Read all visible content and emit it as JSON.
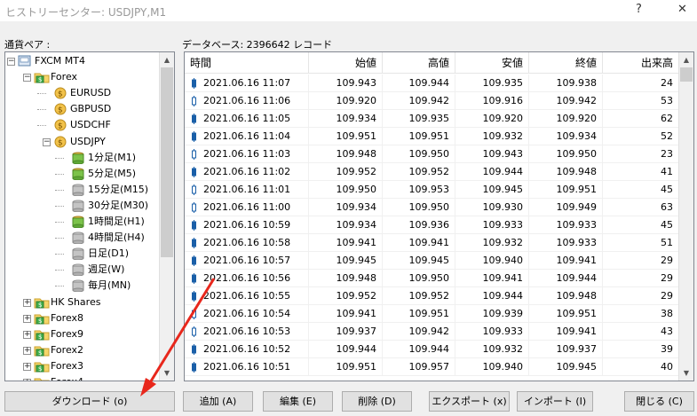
{
  "window": {
    "title": "ヒストリーセンター: USDJPY,M1",
    "help": "?",
    "close": "✕"
  },
  "left": {
    "label": "通貨ペア :"
  },
  "right": {
    "label": "データベース: 2396642 レコード"
  },
  "tree": [
    {
      "text": "FXCM MT4",
      "icon": "server-icon"
    },
    {
      "text": "Forex",
      "icon": "folder-icon"
    },
    {
      "text": "EURUSD",
      "icon": "symbol-icon"
    },
    {
      "text": "GBPUSD",
      "icon": "symbol-icon"
    },
    {
      "text": "USDCHF",
      "icon": "symbol-icon"
    },
    {
      "text": "USDJPY",
      "icon": "symbol-icon"
    },
    {
      "text": "1分足(M1)",
      "icon": "db-green-icon"
    },
    {
      "text": "5分足(M5)",
      "icon": "db-green-icon"
    },
    {
      "text": "15分足(M15)",
      "icon": "db-gray-icon"
    },
    {
      "text": "30分足(M30)",
      "icon": "db-gray-icon"
    },
    {
      "text": "1時間足(H1)",
      "icon": "db-green-icon"
    },
    {
      "text": "4時間足(H4)",
      "icon": "db-gray-icon"
    },
    {
      "text": "日足(D1)",
      "icon": "db-gray-icon"
    },
    {
      "text": "週足(W)",
      "icon": "db-gray-icon"
    },
    {
      "text": "毎月(MN)",
      "icon": "db-gray-icon"
    },
    {
      "text": "HK Shares",
      "icon": "folder-icon"
    },
    {
      "text": "Forex8",
      "icon": "folder-icon"
    },
    {
      "text": "Forex9",
      "icon": "folder-icon"
    },
    {
      "text": "Forex2",
      "icon": "folder-icon"
    },
    {
      "text": "Forex3",
      "icon": "folder-icon"
    },
    {
      "text": "Forex4",
      "icon": "folder-icon"
    }
  ],
  "table": {
    "headers": [
      "時間",
      "始値",
      "高値",
      "安値",
      "終値",
      "出来高"
    ],
    "rows": [
      [
        "2021.06.16 11:07",
        "109.943",
        "109.944",
        "109.935",
        "109.938",
        "24"
      ],
      [
        "2021.06.16 11:06",
        "109.920",
        "109.942",
        "109.916",
        "109.942",
        "53"
      ],
      [
        "2021.06.16 11:05",
        "109.934",
        "109.935",
        "109.920",
        "109.920",
        "62"
      ],
      [
        "2021.06.16 11:04",
        "109.951",
        "109.951",
        "109.932",
        "109.934",
        "52"
      ],
      [
        "2021.06.16 11:03",
        "109.948",
        "109.950",
        "109.943",
        "109.950",
        "23"
      ],
      [
        "2021.06.16 11:02",
        "109.952",
        "109.952",
        "109.944",
        "109.948",
        "41"
      ],
      [
        "2021.06.16 11:01",
        "109.950",
        "109.953",
        "109.945",
        "109.951",
        "45"
      ],
      [
        "2021.06.16 11:00",
        "109.934",
        "109.950",
        "109.930",
        "109.949",
        "63"
      ],
      [
        "2021.06.16 10:59",
        "109.934",
        "109.936",
        "109.933",
        "109.933",
        "45"
      ],
      [
        "2021.06.16 10:58",
        "109.941",
        "109.941",
        "109.932",
        "109.933",
        "51"
      ],
      [
        "2021.06.16 10:57",
        "109.945",
        "109.945",
        "109.940",
        "109.941",
        "29"
      ],
      [
        "2021.06.16 10:56",
        "109.948",
        "109.950",
        "109.941",
        "109.944",
        "29"
      ],
      [
        "2021.06.16 10:55",
        "109.952",
        "109.952",
        "109.944",
        "109.948",
        "29"
      ],
      [
        "2021.06.16 10:54",
        "109.941",
        "109.951",
        "109.939",
        "109.951",
        "38"
      ],
      [
        "2021.06.16 10:53",
        "109.937",
        "109.942",
        "109.933",
        "109.941",
        "43"
      ],
      [
        "2021.06.16 10:52",
        "109.944",
        "109.944",
        "109.932",
        "109.937",
        "39"
      ],
      [
        "2021.06.16 10:51",
        "109.951",
        "109.957",
        "109.940",
        "109.945",
        "40"
      ]
    ]
  },
  "buttons": {
    "download": "ダウンロード (o)",
    "add": "追加 (A)",
    "edit": "編集 (E)",
    "delete": "削除 (D)",
    "export": "エクスポート (x)",
    "import": "インポート (I)",
    "close": "閉じる (C)"
  },
  "colors": {
    "annotation_arrow": "#e8271c",
    "candle_up": "#1a5fa8",
    "candle_down": "#1a5fa8"
  }
}
